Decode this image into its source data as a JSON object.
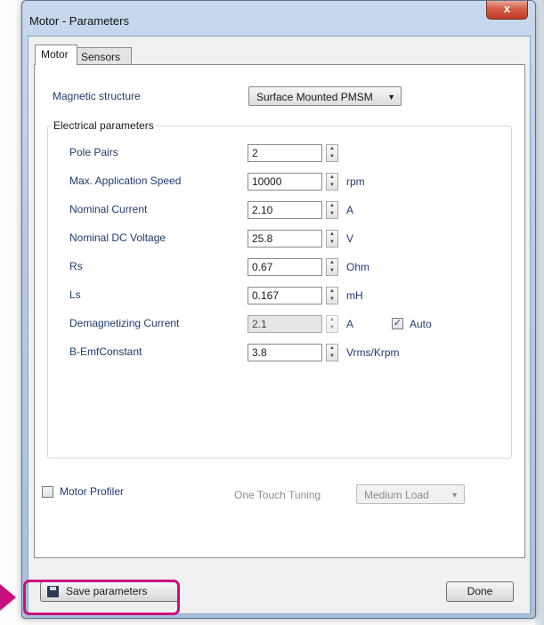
{
  "window": {
    "title": "Motor - Parameters",
    "close_glyph": "x"
  },
  "tabs": [
    {
      "label": "Motor",
      "active": true
    },
    {
      "label": "Sensors",
      "active": false
    }
  ],
  "magnetic_structure": {
    "label": "Magnetic structure",
    "value": "Surface Mounted PMSM"
  },
  "electrical": {
    "title": "Electrical parameters",
    "rows": [
      {
        "label": "Pole Pairs",
        "value": "2",
        "unit": ""
      },
      {
        "label": "Max. Application Speed",
        "value": "10000",
        "unit": "rpm"
      },
      {
        "label": "Nominal Current",
        "value": "2.10",
        "unit": "A"
      },
      {
        "label": "Nominal DC Voltage",
        "value": "25.8",
        "unit": "V"
      },
      {
        "label": "Rs",
        "value": "0.67",
        "unit": "Ohm"
      },
      {
        "label": "Ls",
        "value": "0.167",
        "unit": "mH"
      },
      {
        "label": "Demagnetizing Current",
        "value": "2.1",
        "unit": "A",
        "disabled": true
      },
      {
        "label": "B-EmfConstant",
        "value": "3.8",
        "unit": "Vrms/Krpm"
      }
    ],
    "auto": {
      "label": "Auto",
      "checked": true
    }
  },
  "motor_profiler": {
    "label": "Motor Profiler",
    "checked": false
  },
  "one_touch": {
    "label": "One Touch Tuning",
    "value": "Medium Load"
  },
  "buttons": {
    "save": "Save parameters",
    "done": "Done"
  },
  "colors": {
    "highlight": "#c8107e",
    "label_blue": "#1f3a73"
  },
  "icons": [
    "close-icon",
    "dropdown-arrow-icon",
    "spin-up-icon",
    "spin-down-icon",
    "checkmark-icon",
    "floppy-disk-icon",
    "pointer-arrow-icon"
  ]
}
